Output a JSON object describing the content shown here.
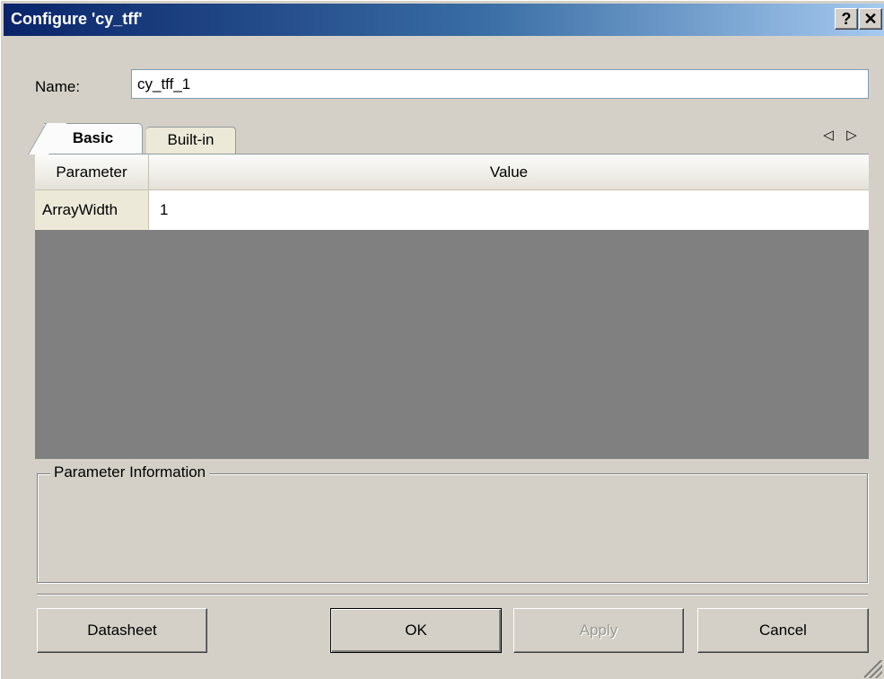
{
  "window": {
    "title": "Configure 'cy_tff'",
    "help_label": "?",
    "close_label": "✕"
  },
  "name_field": {
    "label": "Name:",
    "value": "cy_tff_1"
  },
  "tabs": [
    {
      "label": "Basic",
      "active": true
    },
    {
      "label": "Built-in",
      "active": false
    }
  ],
  "tab_scroll": {
    "left_icon": "◁",
    "right_icon": "▷"
  },
  "grid": {
    "columns": [
      "Parameter",
      "Value"
    ],
    "rows": [
      {
        "parameter": "ArrayWidth",
        "value": "1"
      }
    ]
  },
  "info_panel": {
    "legend": "Parameter Information"
  },
  "buttons": {
    "datasheet": "Datasheet",
    "ok": "OK",
    "apply": "Apply",
    "cancel": "Cancel"
  },
  "colors": {
    "title_gradient_start": "#0a246a",
    "title_gradient_end": "#a6caf0",
    "dialog_bg": "#d4d0c8",
    "grid_empty_bg": "#808080"
  }
}
